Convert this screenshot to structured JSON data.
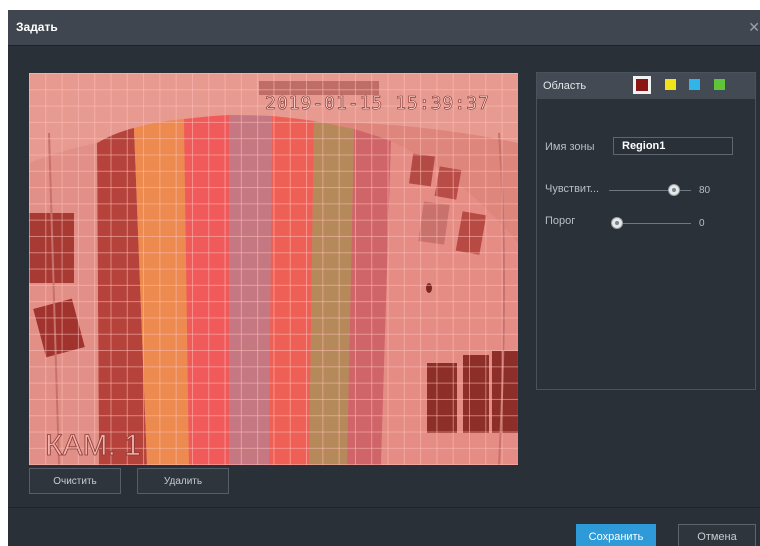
{
  "dialog": {
    "title": "Задать",
    "close_icon": "close-icon"
  },
  "preview": {
    "osd_datetime": "2019-01-15 15:39:37",
    "osd_camera": "КАМ. 1"
  },
  "actions": {
    "clear_label": "Очистить",
    "delete_label": "Удалить"
  },
  "panel": {
    "title": "Область",
    "swatches": [
      {
        "name": "red",
        "color": "#8b1414",
        "selected": true
      },
      {
        "name": "yellow",
        "color": "#f0e31a",
        "selected": false
      },
      {
        "name": "blue",
        "color": "#2fb5ea",
        "selected": false
      },
      {
        "name": "green",
        "color": "#5fc43a",
        "selected": false
      }
    ],
    "zone_name_label": "Имя зоны",
    "zone_name_value": "Region1",
    "sensitivity": {
      "label": "Чувствит...",
      "value": "80"
    },
    "threshold": {
      "label": "Порог",
      "value": "0"
    }
  },
  "footer": {
    "save_label": "Сохранить",
    "cancel_label": "Отмена"
  },
  "colors": {
    "accent": "#2e9ad8",
    "mask_overlay": "#e86a60",
    "background": "#2a3038"
  }
}
